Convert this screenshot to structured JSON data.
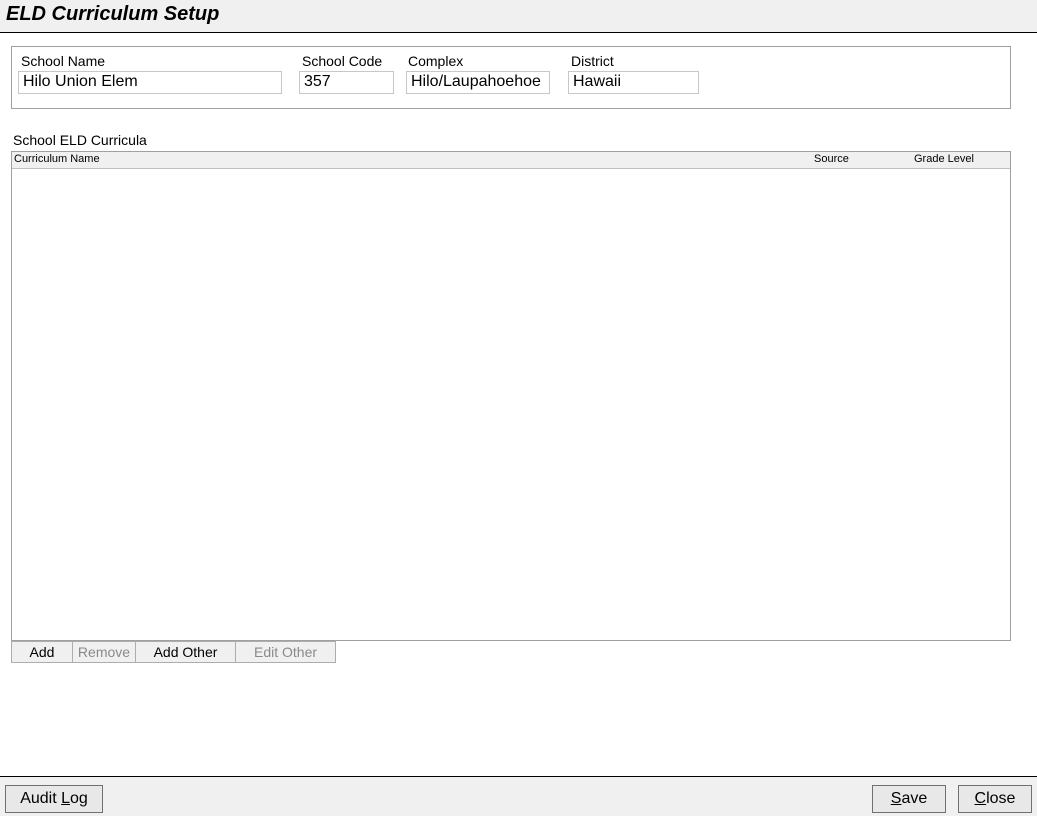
{
  "window": {
    "title": "ELD Curriculum Setup"
  },
  "school": {
    "name_label": "School Name",
    "name_value": "Hilo Union Elem",
    "code_label": "School Code",
    "code_value": "357",
    "complex_label": "Complex",
    "complex_value": "Hilo/Laupahoehoe",
    "district_label": "District",
    "district_value": "Hawaii"
  },
  "curricula": {
    "section_label": "School ELD Curricula",
    "columns": [
      "Curriculum Name",
      "Source",
      "Grade Level"
    ],
    "rows": []
  },
  "grid_buttons": {
    "add": "Add",
    "remove": "Remove",
    "add_other": "Add Other",
    "edit_other": "Edit Other"
  },
  "footer": {
    "audit_log_pre": "Audit ",
    "audit_log_key": "L",
    "audit_log_post": "og",
    "save_key": "S",
    "save_post": "ave",
    "close_key": "C",
    "close_post": "lose"
  }
}
